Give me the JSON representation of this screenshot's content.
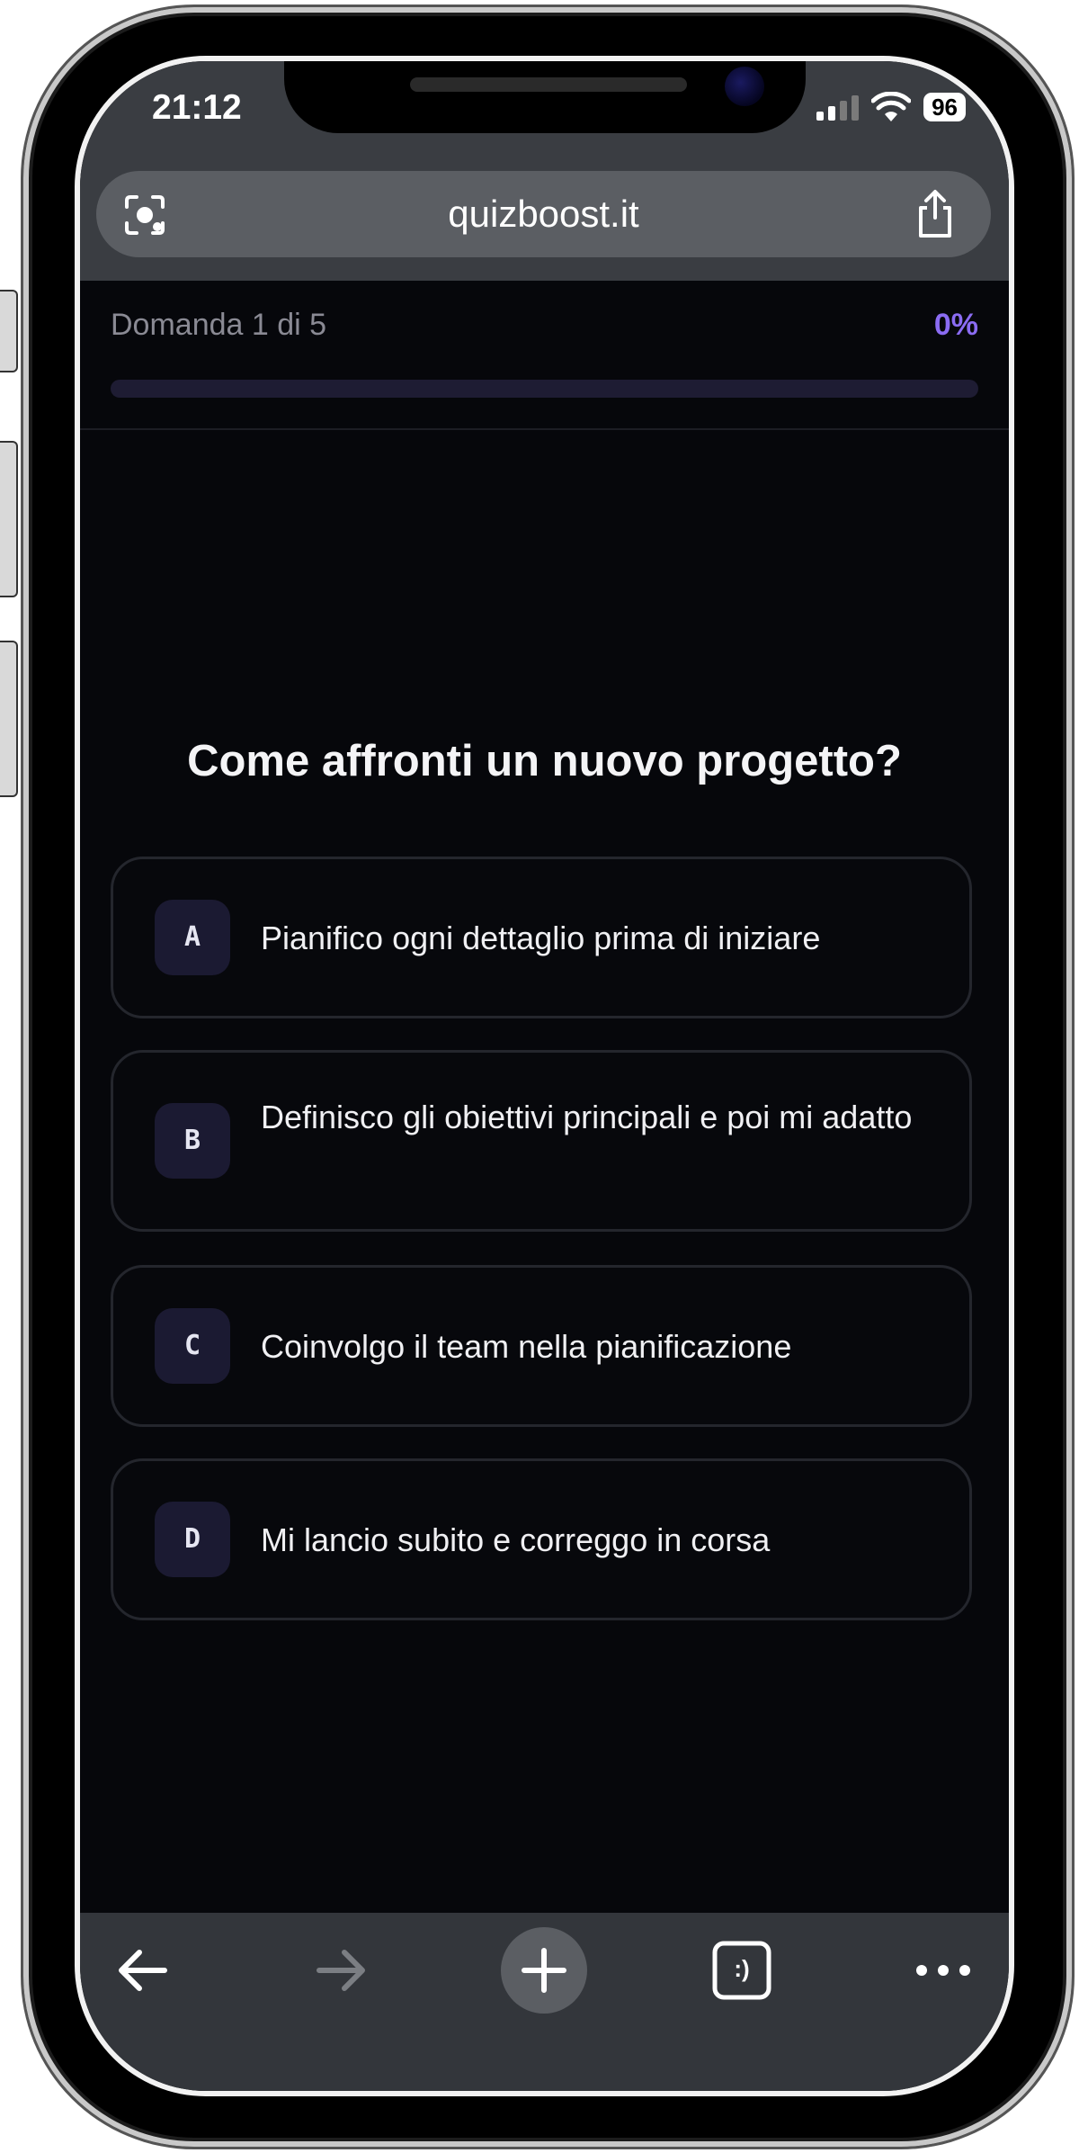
{
  "status_bar": {
    "time": "21:12",
    "battery": "96"
  },
  "browser": {
    "url": "quizboost.it"
  },
  "quiz": {
    "counter": "Domanda 1 di 5",
    "percent_label": "0%",
    "progress": 0,
    "question": "Come affronti un nuovo progetto?",
    "answers": [
      {
        "letter": "A",
        "text": "Pianifico ogni dettaglio prima di iniziare"
      },
      {
        "letter": "B",
        "text": "Definisco gli obiettivi principali e poi mi adatto"
      },
      {
        "letter": "C",
        "text": "Coinvolgo il team nella pianificazione"
      },
      {
        "letter": "D",
        "text": "Mi lancio subito e correggo in corsa"
      }
    ]
  },
  "colors": {
    "accent": "#8b6cf3",
    "page_bg": "#06070b",
    "chrome_bg": "#3a3d42"
  },
  "icons": {
    "url_left": "camera-search-icon",
    "url_right": "share-icon",
    "toolbar": [
      "back-arrow-icon",
      "forward-arrow-icon",
      "new-tab-plus-icon",
      "tabs-switcher-icon",
      "more-options-icon"
    ]
  },
  "tab_switcher_glyph": ":)"
}
